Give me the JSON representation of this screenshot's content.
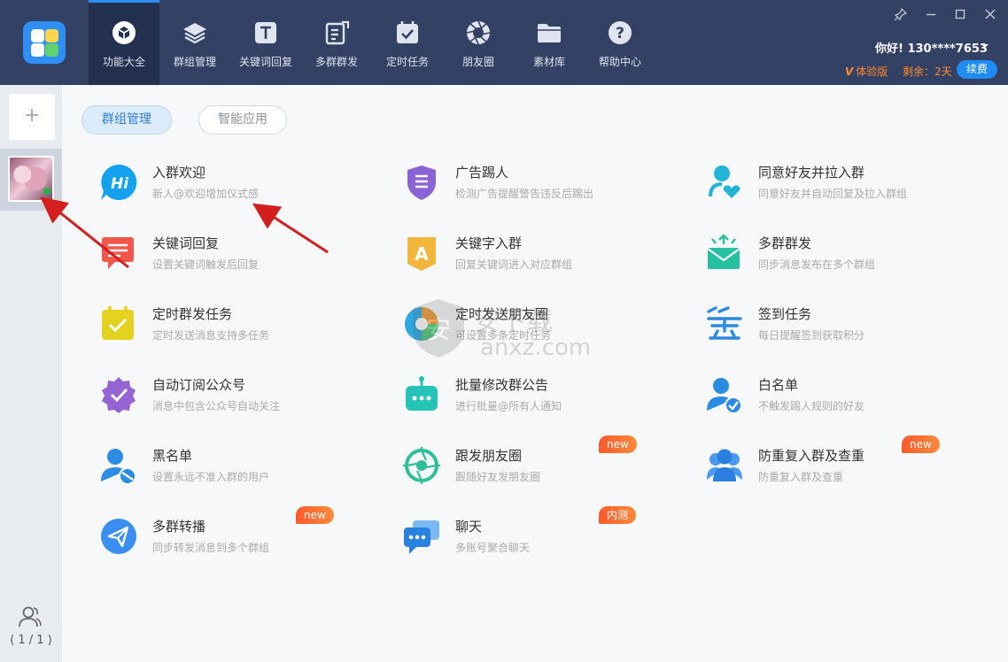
{
  "nav": [
    {
      "label": "功能大全",
      "icon": "cube-icon",
      "active": true
    },
    {
      "label": "群组管理",
      "icon": "layers-icon"
    },
    {
      "label": "关键词回复",
      "icon": "text-t-icon"
    },
    {
      "label": "多群群发",
      "icon": "edit-send-icon"
    },
    {
      "label": "定时任务",
      "icon": "calendar-check-icon"
    },
    {
      "label": "朋友圈",
      "icon": "aperture-icon"
    },
    {
      "label": "素材库",
      "icon": "folder-icon"
    },
    {
      "label": "帮助中心",
      "icon": "help-icon"
    }
  ],
  "user": {
    "greeting": "你好! 130****7653",
    "trial": "体验版",
    "remain": "剩余：2天",
    "renew": "续费"
  },
  "sidebar": {
    "add": "+",
    "count": "( 1 / 1 )"
  },
  "tabs": {
    "active": "群组管理",
    "inactive": "智能应用"
  },
  "features": [
    {
      "title": "入群欢迎",
      "desc": "新人@欢迎增加仪式感",
      "icon": "hi-bubble-icon"
    },
    {
      "title": "广告踢人",
      "desc": "检测广告提醒警告违反后踢出",
      "icon": "shield-icon"
    },
    {
      "title": "同意好友并拉入群",
      "desc": "同意好友并自动回复及拉入群组",
      "icon": "user-heart-icon"
    },
    {
      "title": "关键词回复",
      "desc": "设置关键词触发后回复",
      "icon": "message-icon"
    },
    {
      "title": "关键字入群",
      "desc": "回复关键词进入对应群组",
      "icon": "letter-a-icon"
    },
    {
      "title": "多群群发",
      "desc": "同步消息发布在多个群组",
      "icon": "mail-up-icon"
    },
    {
      "title": "定时群发任务",
      "desc": "定时发送消息支持多任务",
      "icon": "calendar-icon"
    },
    {
      "title": "定时发送朋友圈",
      "desc": "可设置多条定时任务",
      "icon": "aperture-color-icon"
    },
    {
      "title": "签到任务",
      "desc": "每日提醒签到获取积分",
      "icon": "sign-in-icon"
    },
    {
      "title": "自动订阅公众号",
      "desc": "消息中包含公众号自动关注",
      "icon": "badge-check-icon"
    },
    {
      "title": "批量修改群公告",
      "desc": "进行批量@所有人通知",
      "icon": "robot-icon"
    },
    {
      "title": "白名单",
      "desc": "不触发踢人规则的好友",
      "icon": "user-check-icon"
    },
    {
      "title": "黑名单",
      "desc": "设置永远不准入群的用户",
      "icon": "user-block-icon"
    },
    {
      "title": "跟发朋友圈",
      "desc": "跟随好友发朋友圈",
      "icon": "aperture-follow-icon",
      "badge": "new"
    },
    {
      "title": "防重复入群及查重",
      "desc": "防重复入群及查重",
      "icon": "users-icon",
      "badge": "new"
    },
    {
      "title": "多群转播",
      "desc": "同步转发消息到多个群组",
      "icon": "send-icon",
      "badge": "new"
    },
    {
      "title": "聊天",
      "desc": "多账号聚合聊天",
      "icon": "chat-icon",
      "badge": "内测"
    }
  ],
  "watermark": {
    "title": "安下载",
    "url": "anxz.com"
  },
  "colors": {
    "topbar": "#334164",
    "accent": "#2f8ff5",
    "badge": "#ff5a2c",
    "arrow": "#d41f1f"
  }
}
